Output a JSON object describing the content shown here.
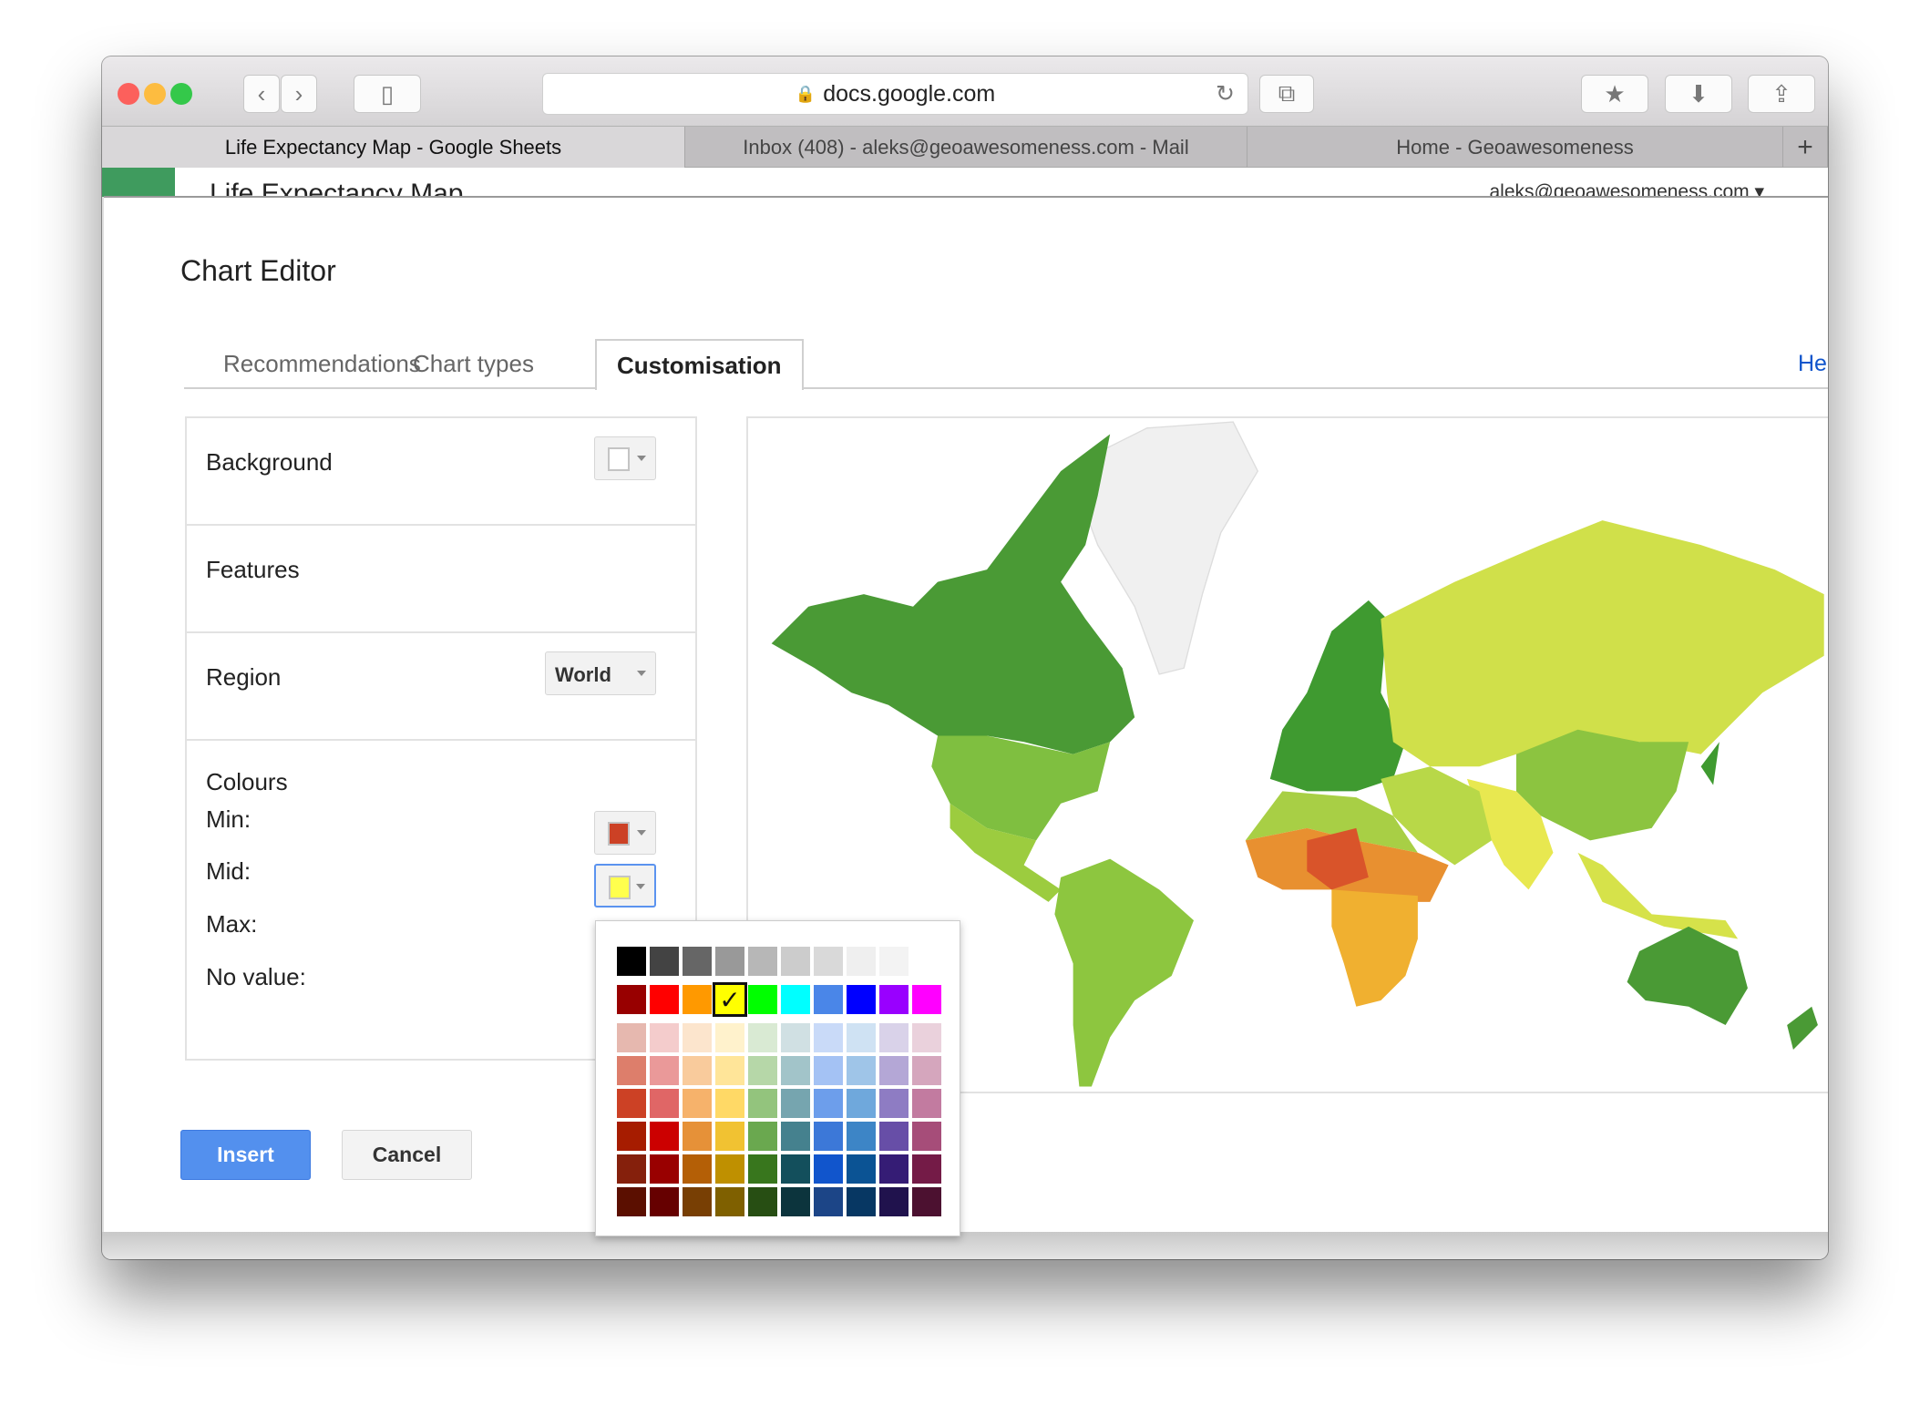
{
  "browser": {
    "url": "docs.google.com",
    "tabs": [
      {
        "label": "Life Expectancy Map - Google Sheets",
        "active": true
      },
      {
        "label": "Inbox (408) - aleks@geoawesomeness.com - Mail",
        "active": false
      },
      {
        "label": "Home - Geoawesomeness",
        "active": false
      }
    ],
    "new_tab": "+"
  },
  "sheet": {
    "title": "Life Expectancy Map",
    "account": "aleks@geoawesomeness.com ▾"
  },
  "editor": {
    "title": "Chart Editor",
    "tabs": [
      "Recommendations",
      "Chart types",
      "Customisation"
    ],
    "active_tab": "Customisation",
    "help": "Hel",
    "sections": {
      "background": "Background",
      "features": "Features",
      "region": "Region",
      "region_value": "World",
      "colours": "Colours",
      "min": "Min:",
      "mid": "Mid:",
      "max": "Max:",
      "no_value": "No value:"
    },
    "colors": {
      "background": "#ffffff",
      "min": "#cc4125",
      "mid": "#ffff4d"
    },
    "insert": "Insert",
    "cancel": "Cancel"
  },
  "palette": {
    "rows": [
      [
        "#000000",
        "#434343",
        "#666666",
        "#999999",
        "#b7b7b7",
        "#cccccc",
        "#d9d9d9",
        "#efefef",
        "#f3f3f3",
        "#ffffff"
      ],
      [
        "#980000",
        "#ff0000",
        "#ff9900",
        "#ffff00",
        "#00ff00",
        "#00ffff",
        "#4a86e8",
        "#0000ff",
        "#9900ff",
        "#ff00ff"
      ],
      [
        "#e6b8af",
        "#f4cccc",
        "#fce5cd",
        "#fff2cc",
        "#d9ead3",
        "#d0e0e3",
        "#c9daf8",
        "#cfe2f3",
        "#d9d2e9",
        "#ead1dc"
      ],
      [
        "#dd7e6b",
        "#ea9999",
        "#f9cb9c",
        "#ffe599",
        "#b6d7a8",
        "#a2c4c9",
        "#a4c2f4",
        "#9fc5e8",
        "#b4a7d6",
        "#d5a6bd"
      ],
      [
        "#cc4125",
        "#e06666",
        "#f6b26b",
        "#ffd966",
        "#93c47d",
        "#76a5af",
        "#6d9eeb",
        "#6fa8dc",
        "#8e7cc3",
        "#c27ba0"
      ],
      [
        "#a61c00",
        "#cc0000",
        "#e69138",
        "#f1c232",
        "#6aa84f",
        "#45818e",
        "#3c78d8",
        "#3d85c6",
        "#674ea7",
        "#a64d79"
      ],
      [
        "#85200c",
        "#990000",
        "#b45f06",
        "#bf9000",
        "#38761d",
        "#134f5c",
        "#1155cc",
        "#0b5394",
        "#351c75",
        "#741b47"
      ],
      [
        "#5b0f00",
        "#660000",
        "#783f04",
        "#7f6000",
        "#274e13",
        "#0c343d",
        "#1c4587",
        "#073763",
        "#20124d",
        "#4c1130"
      ]
    ],
    "selected": "#ffff00",
    "check": "✓"
  },
  "chart_data": {
    "type": "geo",
    "region": "World",
    "color_min": "#cc4125",
    "color_mid": "#ffff4d",
    "color_max": "#3f9a30",
    "no_value": "#f0f0f0"
  }
}
